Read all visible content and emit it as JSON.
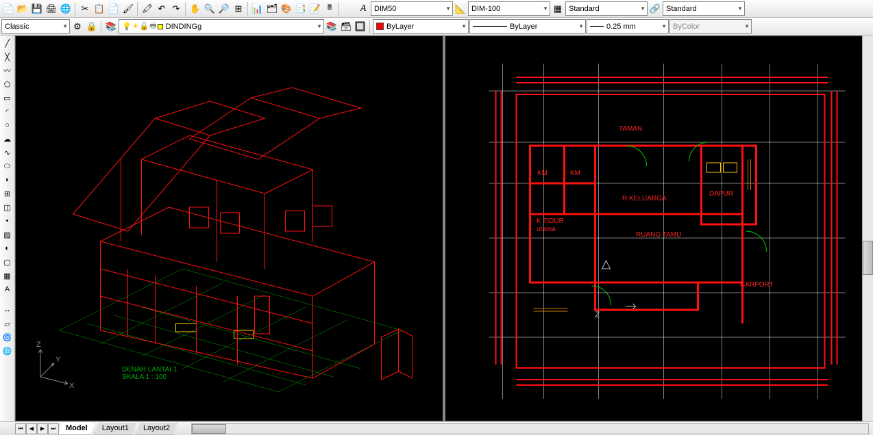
{
  "toolbar1": {
    "textStyle": "DIM50",
    "dimStyle": "DIM-100",
    "tableStyle": "Standard",
    "mlStyle": "Standard"
  },
  "toolbar2": {
    "workspace": "Classic",
    "layer": "DINDINGg",
    "colorLabel": "ByLayer",
    "linetypeLabel": "ByLayer",
    "lineweightLabel": "0.25 mm",
    "plotstyleLabel": "ByColor"
  },
  "axes": {
    "x": "X",
    "y": "Y",
    "z": "Z"
  },
  "isoView": {
    "titleLine1": "DENAH LANTAI 1",
    "titleLine2": "SKALA 1 : 100"
  },
  "floorPlan": {
    "labels": {
      "taman": "TAMAN",
      "km1": "KM",
      "km2": "KM",
      "rkeluarga": "R.KELUARGA",
      "dapur": "DAPUR",
      "ktidur1": "K TIDUR",
      "ktidur2": "utama",
      "rtamu": "RUANG TAMU",
      "carport": "CARPORT",
      "z": "Z"
    }
  },
  "tabs": {
    "model": "Model",
    "layout1": "Layout1",
    "layout2": "Layout2"
  }
}
